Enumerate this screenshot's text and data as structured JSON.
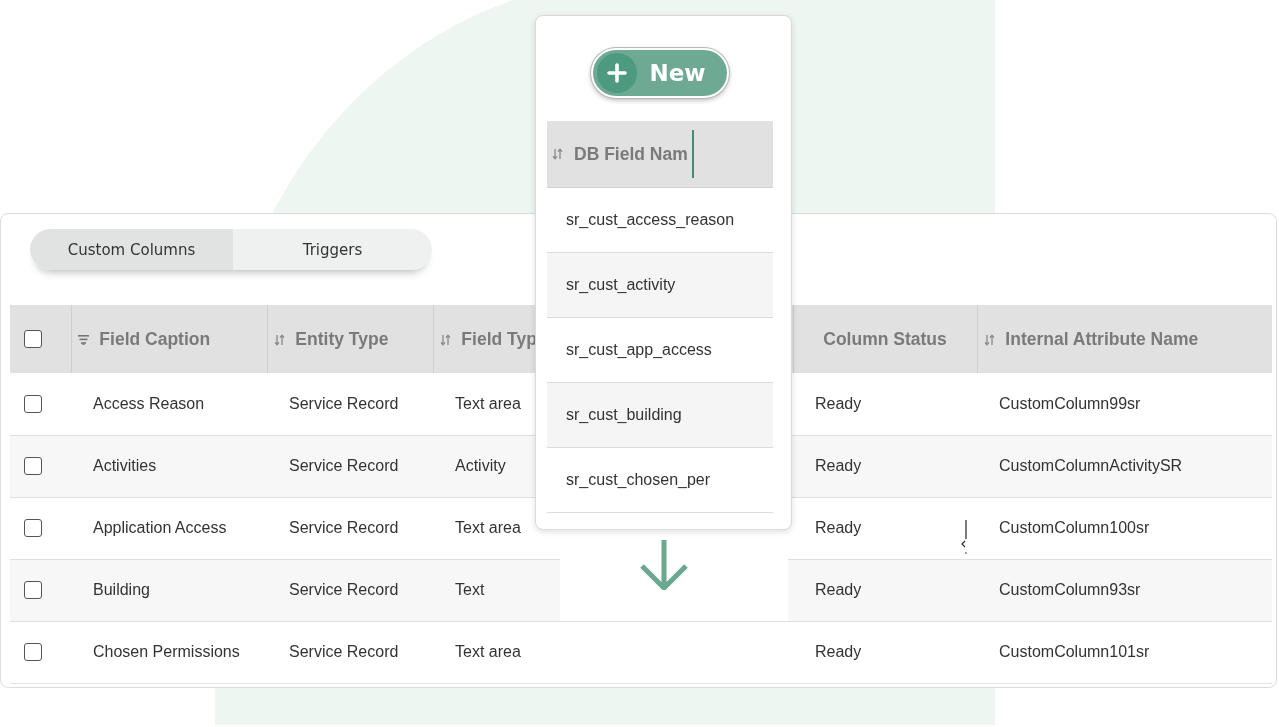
{
  "tabs": [
    {
      "label": "Custom Columns",
      "selected": true
    },
    {
      "label": "Triggers",
      "selected": false
    }
  ],
  "table": {
    "select_all": {
      "checked": false
    },
    "columns": [
      {
        "label": "Field Caption",
        "kind": "filter"
      },
      {
        "label": "Entity Type",
        "kind": "sort"
      },
      {
        "label": "Field Typ",
        "kind": "sort"
      },
      {
        "label": "Column Status",
        "kind": "plain"
      },
      {
        "label": "Internal Attribute Name",
        "kind": "sort"
      }
    ],
    "rows": [
      {
        "checked": false,
        "cells": [
          "Access Reason",
          "Service Record",
          "Text area",
          "Ready",
          "CustomColumn99sr"
        ]
      },
      {
        "checked": false,
        "cells": [
          "Activities",
          "Service Record",
          "Activity",
          "Ready",
          "CustomColumnActivitySR"
        ]
      },
      {
        "checked": false,
        "cells": [
          "Application Access",
          "Service Record",
          "Text area",
          "Ready",
          "CustomColumn100sr"
        ]
      },
      {
        "checked": false,
        "cells": [
          "Building",
          "Service Record",
          "Text",
          "Ready",
          "CustomColumn93sr"
        ]
      },
      {
        "checked": false,
        "cells": [
          "Chosen Permissions",
          "Service Record",
          "Text area",
          "Ready",
          "CustomColumn101sr"
        ]
      }
    ]
  },
  "column_popup": {
    "button": {
      "label": "New"
    },
    "column": {
      "label": "DB Field Nam",
      "kind": "sort"
    },
    "cells": [
      "sr_cust_access_reason",
      "sr_cust_activity",
      "sr_cust_app_access",
      "sr_cust_building",
      "sr_cust_chosen_per"
    ]
  }
}
